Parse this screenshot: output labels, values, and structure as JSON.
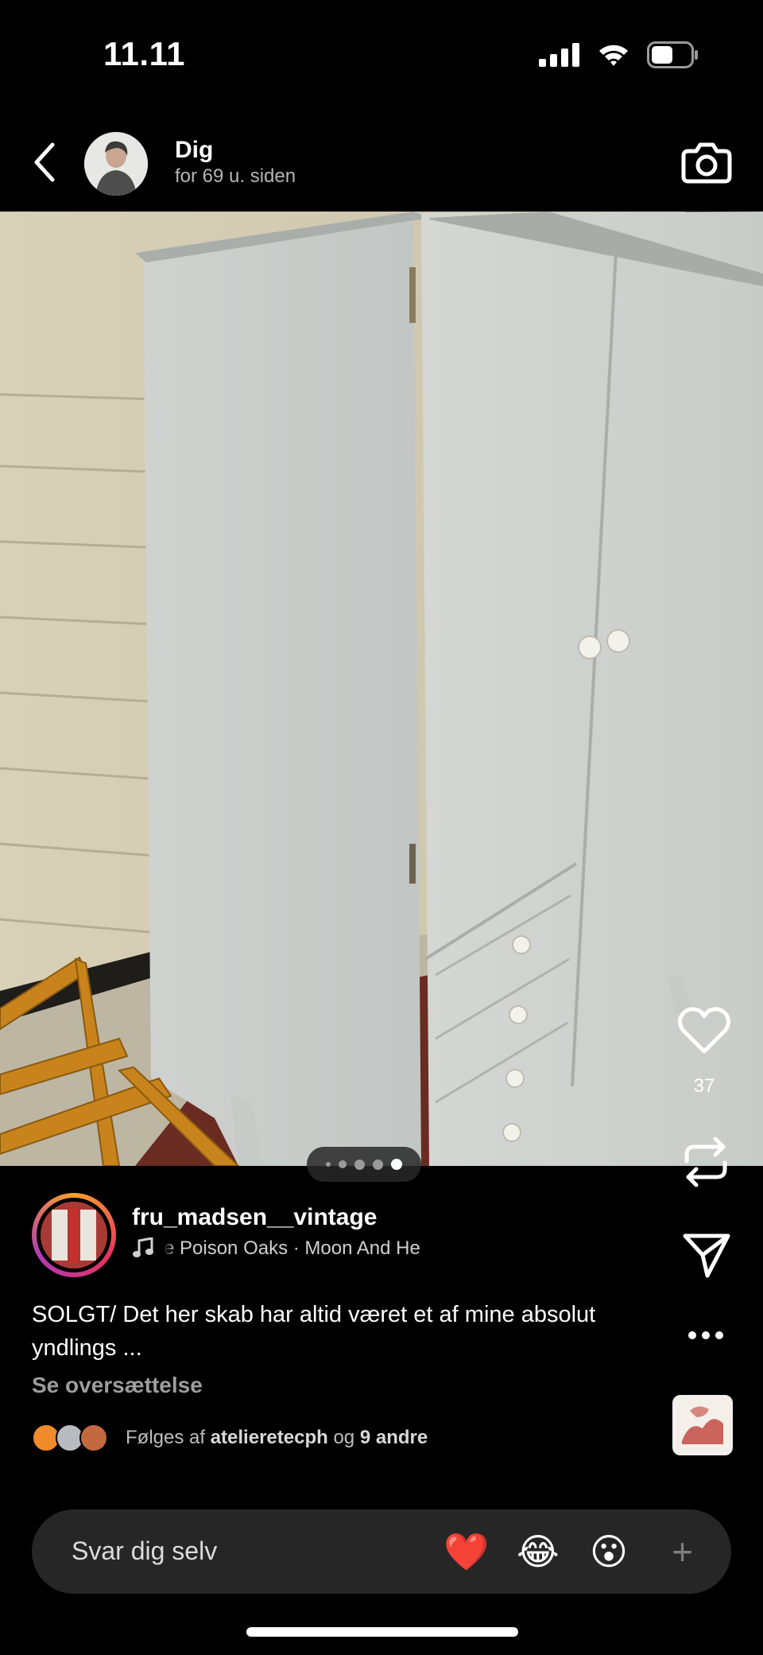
{
  "status_bar": {
    "time": "11.11"
  },
  "header": {
    "name": "Dig",
    "time_ago": "for 69 u. siden"
  },
  "carousel": {
    "count": 5,
    "active_index": 4
  },
  "actions": {
    "like_count": "37"
  },
  "post": {
    "username": "fru_madsen__vintage",
    "music": "e Poison Oaks · Moon And He",
    "caption": "SOLGT/ Det her skab har altid været et af mine absolut yndlings ...",
    "translate_label": "Se oversættelse",
    "followed_prefix": "Følges af",
    "followed_user": "atelieretecph",
    "followed_conj": "og",
    "followed_others": "9 andre"
  },
  "reply": {
    "placeholder": "Svar dig selv",
    "reactions": [
      "❤️",
      "😂",
      "😮"
    ],
    "plus": "+"
  },
  "icons": [
    "chevron-left-icon",
    "camera-icon",
    "heart-icon",
    "repost-icon",
    "send-icon",
    "more-icon",
    "music-note-icon"
  ]
}
